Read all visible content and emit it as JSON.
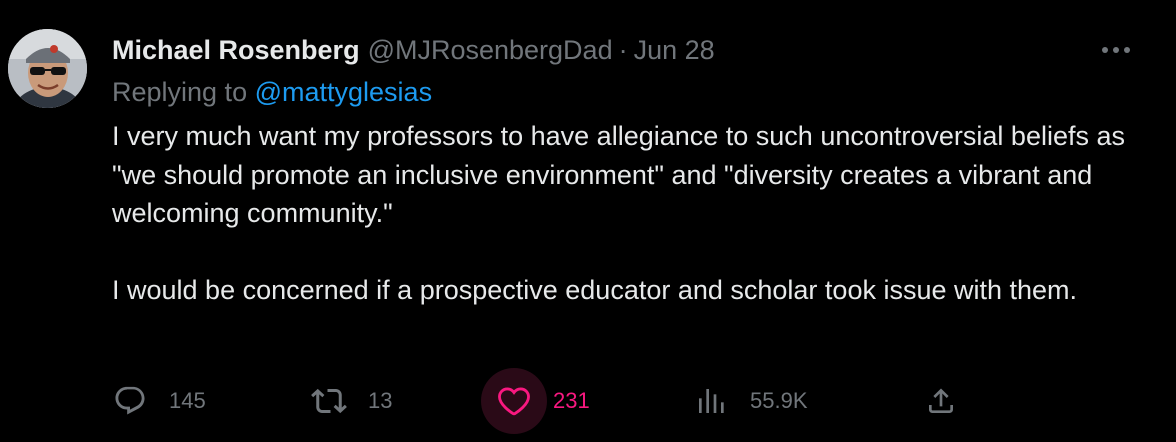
{
  "tweet": {
    "author": {
      "display_name": "Michael Rosenberg",
      "handle": "@MJRosenbergDad",
      "avatar_icon": "avatar-photo"
    },
    "separator": "·",
    "date": "Jun 28",
    "replying_to_label": "Replying to",
    "replying_to_handle": "@mattyglesias",
    "text_paragraphs": [
      "I very much want my professors to have allegiance to such uncontroversial beliefs as \"we should promote an inclusive environment\" and \"diversity creates a vibrant and welcoming community.\"",
      "I would be concerned if a prospective educator and scholar took issue with them."
    ],
    "more_icon": "more-horizontal-icon"
  },
  "actions": {
    "reply": {
      "icon": "reply-bubble-icon",
      "count": "145"
    },
    "retweet": {
      "icon": "retweet-icon",
      "count": "13"
    },
    "like": {
      "icon": "heart-icon",
      "count": "231",
      "active": true
    },
    "views": {
      "icon": "views-bar-chart-icon",
      "count": "55.9K"
    },
    "share": {
      "icon": "share-upload-icon"
    }
  },
  "colors": {
    "background": "#000000",
    "text_primary": "#e7e9ea",
    "text_secondary": "#71767b",
    "link": "#1d9bf0",
    "like_active": "#f91880"
  }
}
